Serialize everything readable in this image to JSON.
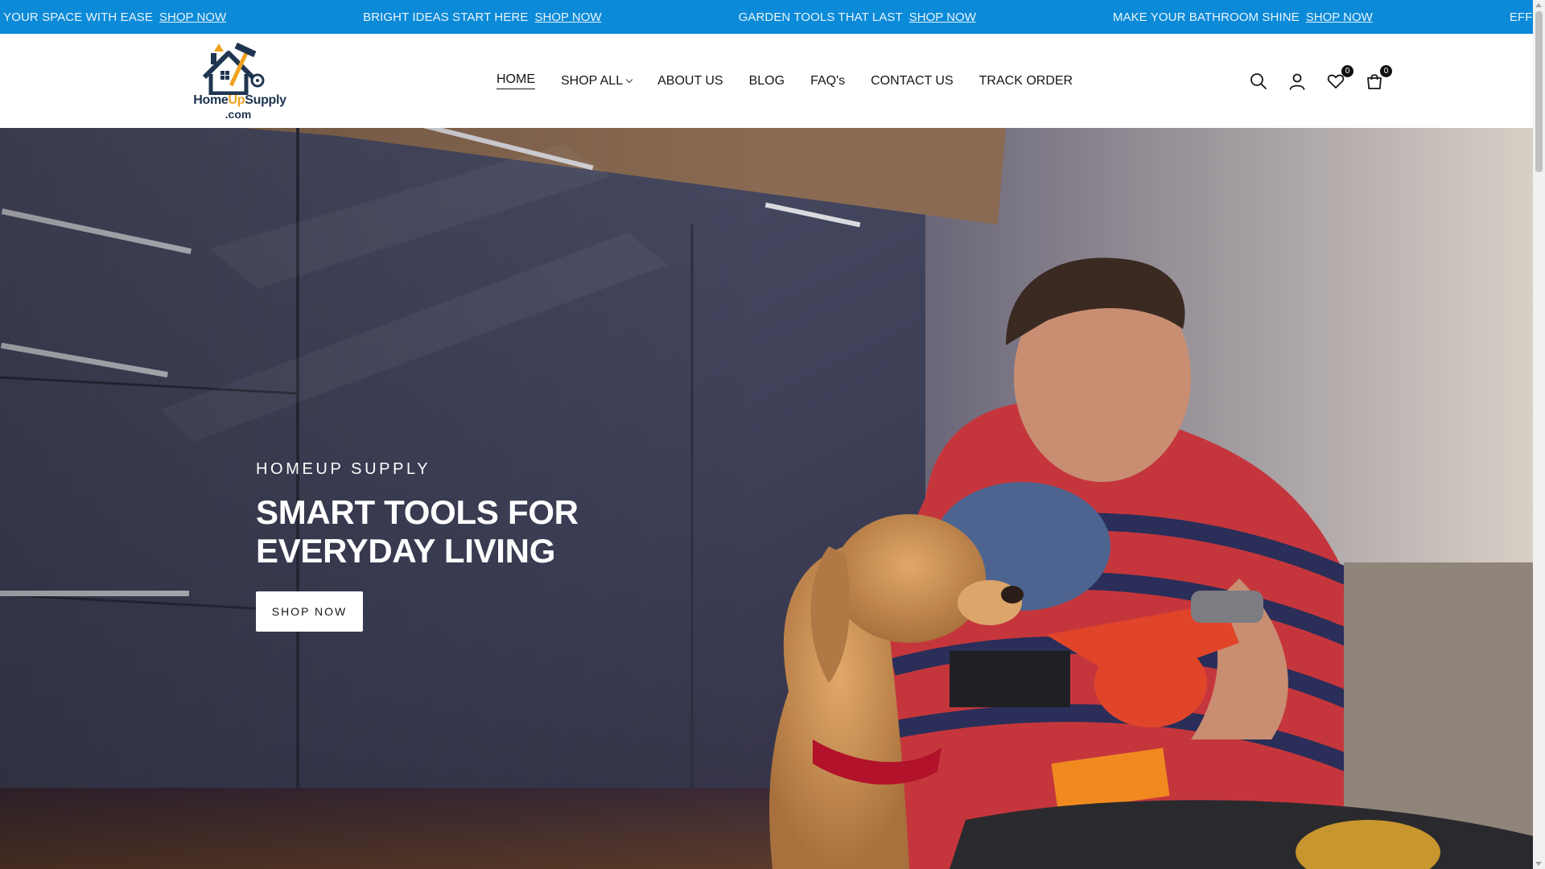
{
  "announcement": {
    "items": [
      {
        "text": "E YOUR SPACE WITH EASE",
        "link": "SHOP NOW"
      },
      {
        "text": "BRIGHT IDEAS START HERE",
        "link": "SHOP NOW"
      },
      {
        "text": "GARDEN TOOLS THAT LAST",
        "link": "SHOP NOW"
      },
      {
        "text": "MAKE YOUR BATHROOM SHINE",
        "link": "SHOP NOW"
      },
      {
        "text": "EFFORTLESS HO",
        "link": ""
      }
    ]
  },
  "logo": {
    "part1": "Home",
    "part2": "Up",
    "part3": "Supply",
    "sub": ".com"
  },
  "nav": {
    "items": [
      "HOME",
      "SHOP ALL",
      "ABOUT US",
      "BLOG",
      "FAQ's",
      "CONTACT US",
      "TRACK ORDER"
    ]
  },
  "header_icons": {
    "search": "search-icon",
    "account": "user-icon",
    "wishlist": "heart-icon",
    "wishlist_count": "0",
    "cart": "cart-icon",
    "cart_count": "0"
  },
  "hero": {
    "eyebrow": "HOMEUP SUPPLY",
    "title": "SMART TOOLS FOR EVERYDAY LIVING",
    "button": "SHOP NOW"
  },
  "colors": {
    "announcement_bg": "#0b8ad8",
    "accent": "#f0a21e",
    "logo_navy": "#1f3550"
  }
}
